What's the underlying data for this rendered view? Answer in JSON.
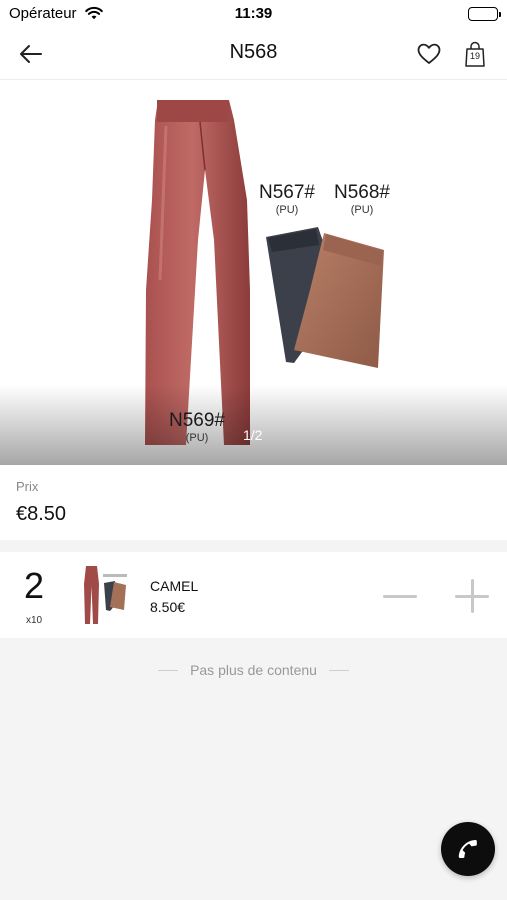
{
  "status_bar": {
    "carrier": "Opérateur",
    "time": "11:39",
    "icons": [
      "wifi-icon",
      "battery-icon"
    ]
  },
  "nav": {
    "title": "N568",
    "back_icon": "arrow-left-icon",
    "favorite_icon": "heart-icon",
    "bag_icon": "shopping-bag-icon",
    "bag_count": "19"
  },
  "gallery": {
    "products": [
      {
        "code": "N567#",
        "material": "(PU)"
      },
      {
        "code": "N568#",
        "material": "(PU)"
      },
      {
        "code": "N569#",
        "material": "(PU)"
      }
    ],
    "page_indicator": "1/2",
    "colors": {
      "red_pants": "#9e4a48",
      "black_pants": "#3a3f4a",
      "camel_pants": "#a47058"
    }
  },
  "price": {
    "label": "Prix",
    "value": "€8.50"
  },
  "variant": {
    "quantity": "2",
    "unit": "x10",
    "color_name": "CAMEL",
    "unit_price": "8.50€",
    "decrement_icon": "minus-icon",
    "increment_icon": "plus-icon"
  },
  "footer": {
    "end_text": "Pas plus de contenu"
  },
  "fab": {
    "icon": "phone-icon"
  }
}
